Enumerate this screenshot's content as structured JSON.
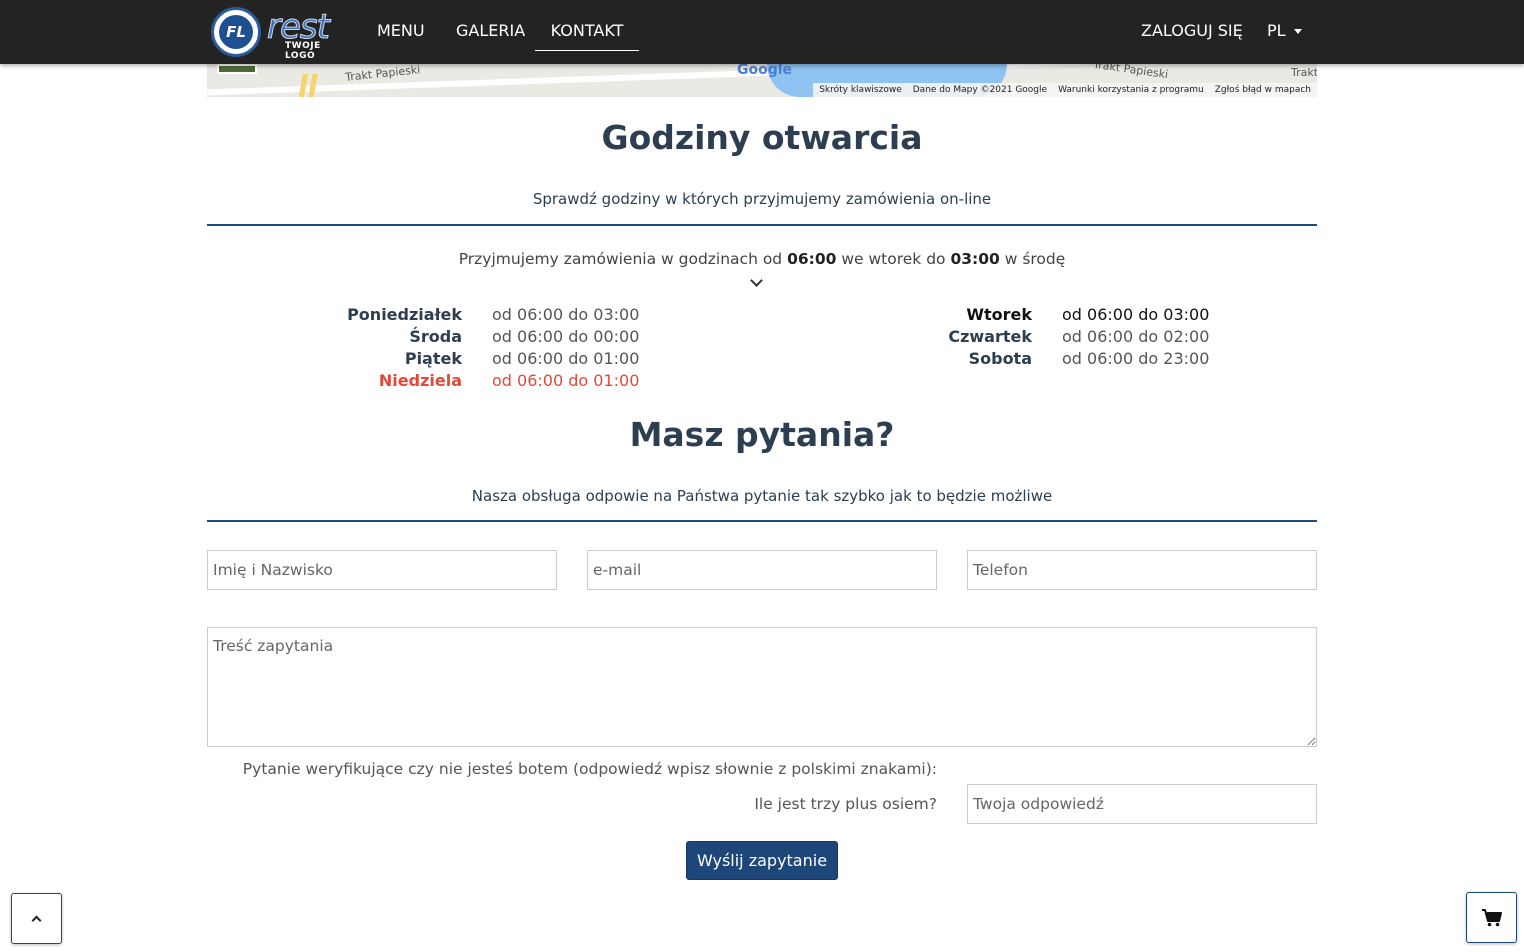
{
  "nav": {
    "logo_text": "rest",
    "logo_badge": "FL",
    "logo_sub": "TWOJE LOGO",
    "links": [
      "MENU",
      "GALERIA",
      "KONTAKT"
    ],
    "login": "ZALOGUJ SIĘ",
    "lang": "PL"
  },
  "map": {
    "road_left": "Trakt Papieski",
    "road_right": "Trakt Papieski",
    "road_far": "Trakt",
    "brand": "Google",
    "attrib": [
      "Skróty klawiszowe",
      "Dane do Mapy ©2021 Google",
      "Warunki korzystania z programu",
      "Zgłoś błąd w mapach"
    ]
  },
  "hours_section": {
    "title": "Godziny otwarcia",
    "subtitle": "Sprawdź godziny w których przyjmujemy zamówienia on-line",
    "info_prefix": "Przyjmujemy zamówienia w godzinach od ",
    "info_from": "06:00",
    "info_mid": " we wtorek do ",
    "info_to": "03:00",
    "info_suffix": " w środę",
    "left": [
      {
        "day": "Poniedziałek",
        "hours": "od 06:00 do 03:00"
      },
      {
        "day": "Środa",
        "hours": "od 06:00 do 00:00"
      },
      {
        "day": "Piątek",
        "hours": "od 06:00 do 01:00"
      },
      {
        "day": "Niedziela",
        "hours": "od 06:00 do 01:00"
      }
    ],
    "right": [
      {
        "day": "Wtorek",
        "hours": "od 06:00 do 03:00"
      },
      {
        "day": "Czwartek",
        "hours": "od 06:00 do 02:00"
      },
      {
        "day": "Sobota",
        "hours": "od 06:00 do 23:00"
      }
    ],
    "colors": {
      "sunday": "#e04a3a",
      "today": "#111111",
      "default": "#2c3e50"
    }
  },
  "contact": {
    "title": "Masz pytania?",
    "subtitle": "Nasza obsługa odpowie na Państwa pytanie tak szybko jak to będzie możliwe",
    "name_placeholder": "Imię i Nazwisko",
    "email_placeholder": "e-mail",
    "phone_placeholder": "Telefon",
    "message_placeholder": "Treść zapytania",
    "verify_text": "Pytanie weryfikujące czy nie jesteś botem (odpowiedź wpisz słownie z polskimi znakami):",
    "verify_question": "Ile jest trzy plus osiem?",
    "verify_placeholder": "Twoja odpowiedź",
    "submit": "Wyślij zapytanie"
  },
  "floating": {
    "up_icon": "chevron-up-icon",
    "cart_icon": "cart-icon"
  }
}
